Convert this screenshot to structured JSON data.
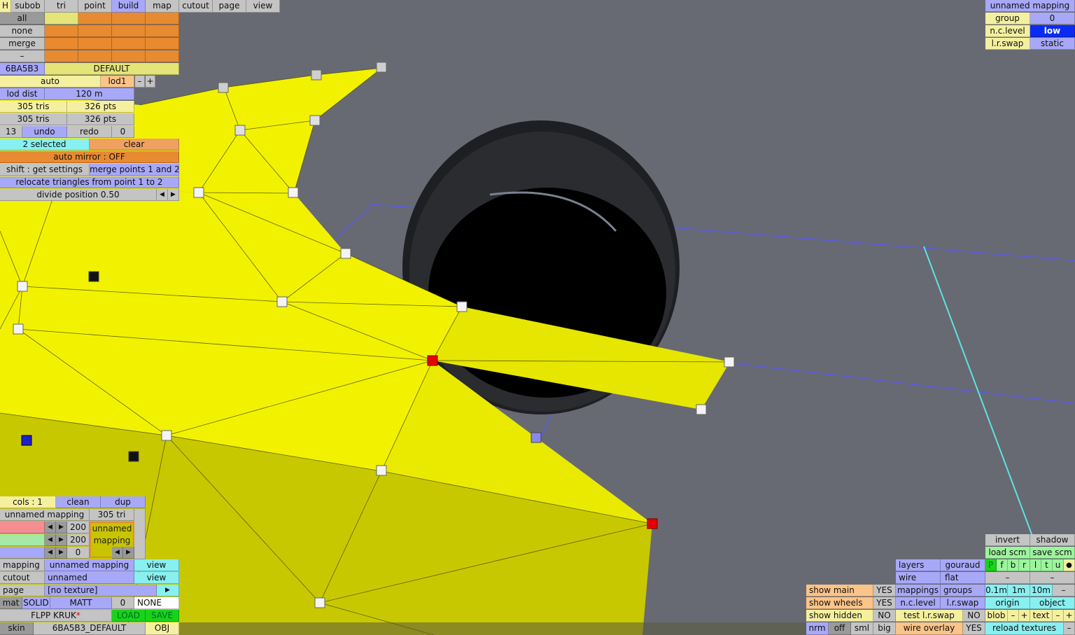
{
  "top_tabs": {
    "h": "H",
    "subob": "subob",
    "tri": "tri",
    "point": "point",
    "build": "build",
    "map": "map",
    "cutout": "cutout",
    "page": "page",
    "view": "view"
  },
  "select_panel": {
    "all": "all",
    "none": "none",
    "merge": "merge",
    "dash": "–"
  },
  "skin_row": {
    "id": "6BA5B3",
    "name": "DEFAULT"
  },
  "lod_panel": {
    "auto": "auto",
    "lod": "lod1",
    "minus": "–",
    "plus": "+",
    "lod_dist_label": "lod dist",
    "lod_dist_value": "120 m",
    "tris_a": "305 tris",
    "pts_a": "326 pts",
    "tris_b": "305 tris",
    "pts_b": "326 pts",
    "undo_count": "13",
    "undo": "undo",
    "redo": "redo",
    "redo_count": "0"
  },
  "selection": {
    "selected": "2 selected",
    "clear": "clear",
    "auto_mirror": "auto mirror : OFF",
    "shift_get": "shift : get settings",
    "merge_points": "merge points 1 and 2",
    "relocate": "relocate triangles from point 1 to 2",
    "divide": "divide position 0.50",
    "arrow_left": "◀",
    "arrow_right": "▶"
  },
  "top_right": {
    "mapping_title": "unnamed mapping",
    "group_label": "group",
    "group_value": "0",
    "nclevel_label": "n.c.level",
    "nclevel_value": "low",
    "lrswap_label": "l.r.swap",
    "lrswap_value": "static"
  },
  "mapping_panel": {
    "cols": "cols : 1",
    "clean": "clean",
    "dup": "dup",
    "mapping_name": "unnamed mapping",
    "tri_count": "305 tri",
    "val_200a": "200",
    "val_200b": "200",
    "val_0": "0",
    "preview_line1": "unnamed",
    "preview_line2": "mapping",
    "arrow_left": "◀",
    "arrow_right": "▶"
  },
  "bottom_left": {
    "mapping_label": "mapping",
    "mapping_value": "unnamed mapping",
    "mapping_view": "view",
    "cutout_label": "cutout",
    "cutout_value": "unnamed",
    "cutout_view": "view",
    "page_label": "page",
    "page_value": "[no texture]",
    "page_arrow": "▶",
    "mat_label": "mat",
    "mat_solid": "SOLID",
    "mat_matt": "MATT",
    "mat_num": "0",
    "mat_none": "NONE",
    "file_name": "FLPP KRUK",
    "file_star": "*",
    "load": "LOAD",
    "save": "SAVE",
    "skin_label": "skin",
    "skin_value": "6BA5B3_DEFAULT",
    "obj": "OBJ"
  },
  "bottom_right": {
    "show_main": "show main",
    "show_main_val": "YES",
    "show_wheels": "show wheels",
    "show_wheels_val": "YES",
    "show_hidden": "show hidden",
    "show_hidden_val": "NO",
    "nrm": "nrm",
    "off": "off",
    "sml": "sml",
    "big": "big",
    "layers": "layers",
    "gouraud": "gouraud",
    "wire": "wire",
    "flat": "flat",
    "mappings": "mappings",
    "groups": "groups",
    "nclevel": "n.c.level",
    "lrswap": "l.r.swap",
    "test_lrswap": "test l.r.swap",
    "test_lrswap_val": "NO",
    "wire_overlay": "wire overlay",
    "wire_overlay_val": "YES",
    "invert": "invert",
    "shadow": "shadow",
    "load_scm": "load scm",
    "save_scm": "save scm",
    "letters": [
      "P",
      "f",
      "b",
      "r",
      "l",
      "t",
      "u"
    ],
    "dot": "●",
    "dash1": "–",
    "dash2": "–",
    "grid1": "0.1m",
    "grid2": "1m",
    "grid3": "10m",
    "grid_minus": "–",
    "origin": "origin",
    "object": "object",
    "blob": "blob",
    "text": "text",
    "minus": "–",
    "plus": "+",
    "reload": "reload textures"
  },
  "colors": {
    "background": "#676a72",
    "mesh_yellow": "#f0f000",
    "mesh_shadow": "#cccc00",
    "selected_point": "#e00000",
    "wire_blue": "#5050e0",
    "guide_cyan": "#50e0e0"
  }
}
